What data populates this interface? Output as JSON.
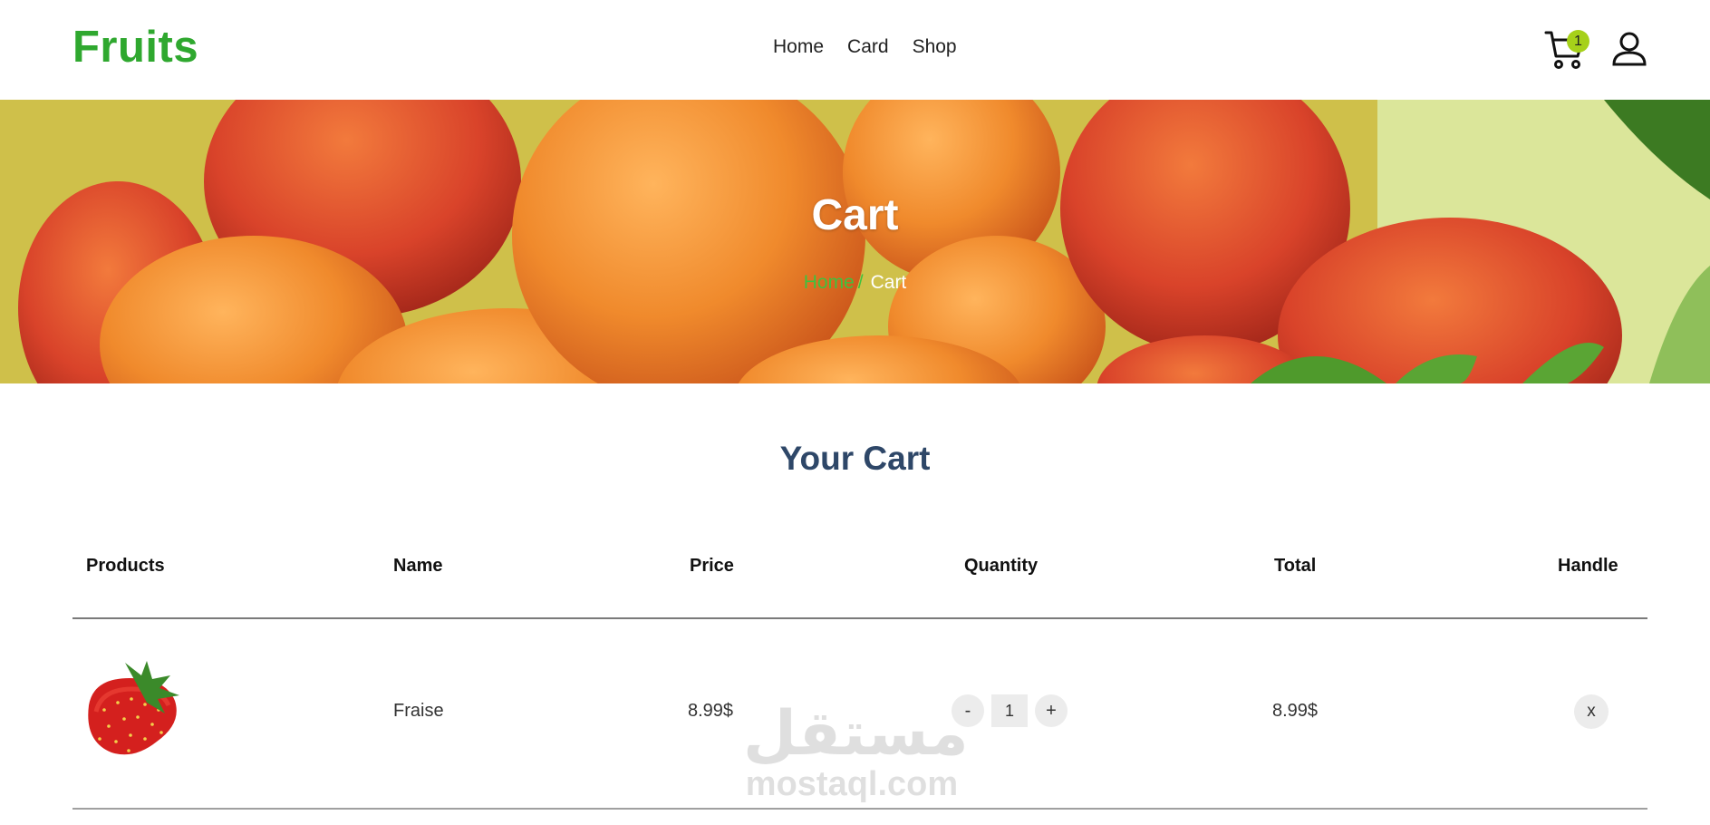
{
  "header": {
    "logo": "Fruits",
    "nav": [
      {
        "label": "Home"
      },
      {
        "label": "Card"
      },
      {
        "label": "Shop"
      }
    ],
    "cart_count": "1",
    "icons": {
      "cart": "cart-icon",
      "user": "user-icon"
    }
  },
  "hero": {
    "title": "Cart",
    "breadcrumb": {
      "home": "Home",
      "separator": "/",
      "current": "Cart"
    }
  },
  "section": {
    "title": "Your Cart"
  },
  "table": {
    "columns": [
      "Products",
      "Name",
      "Price",
      "Quantity",
      "Total",
      "Handle"
    ],
    "rows": [
      {
        "image": "strawberry",
        "name": "Fraise",
        "price": "8.99$",
        "quantity": "1",
        "total": "8.99$",
        "decrement": "-",
        "increment": "+",
        "remove": "x"
      }
    ]
  },
  "watermark": {
    "arabic": "مستقل",
    "latin": "mostaql.com"
  },
  "colors": {
    "brand": "#2fa82f",
    "badge": "#a6d11a",
    "title": "#2e4768",
    "crumb": "#3ec23e"
  }
}
